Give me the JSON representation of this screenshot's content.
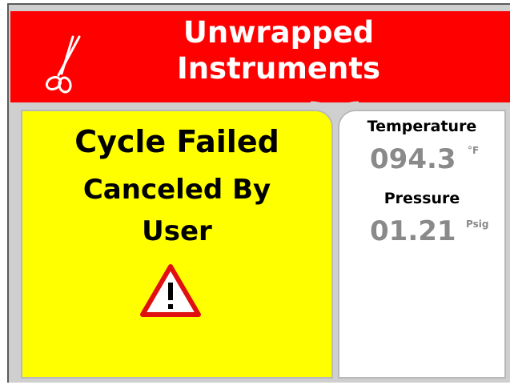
{
  "header": {
    "title_line1": "Unwrapped",
    "title_line2": "Instruments",
    "icon": "scissors-icon",
    "background_color": "#ff0000"
  },
  "status": {
    "line1": "Cycle Failed",
    "line2": "Canceled By",
    "line3": "User",
    "icon": "warning-icon",
    "background_color": "#ffff00"
  },
  "readings": {
    "temperature": {
      "label": "Temperature",
      "value": "094.3",
      "unit": "°F"
    },
    "pressure": {
      "label": "Pressure",
      "value": "01.21",
      "unit": "Psig"
    }
  }
}
